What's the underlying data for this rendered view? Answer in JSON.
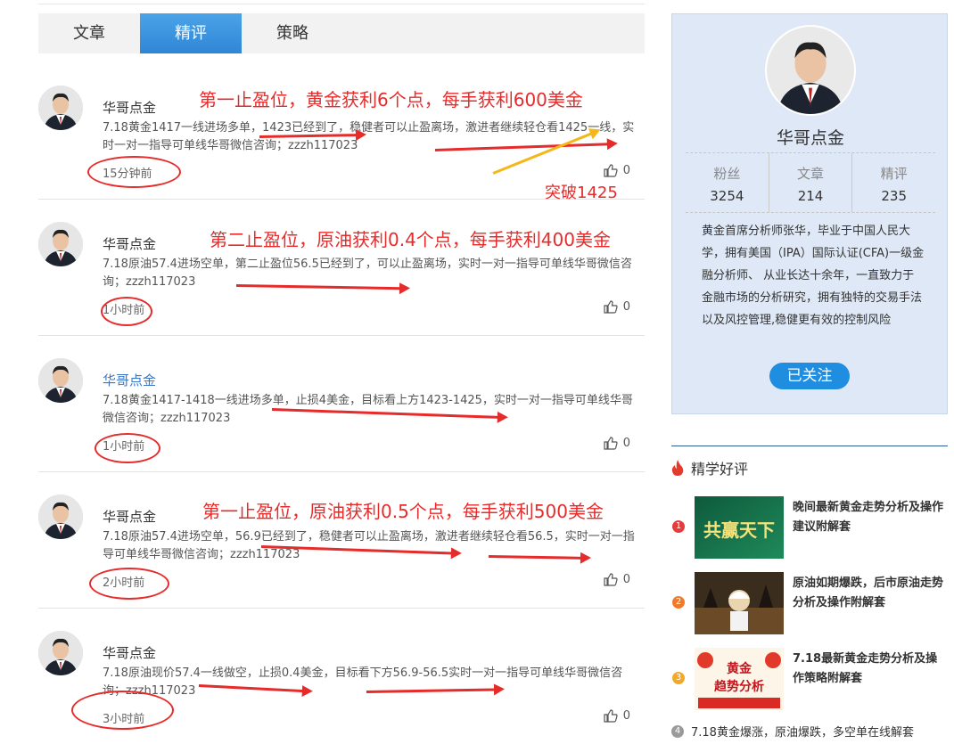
{
  "tabs": [
    {
      "label": "文章"
    },
    {
      "label": "精评"
    },
    {
      "label": "策略"
    }
  ],
  "posts": [
    {
      "author": "华哥点金",
      "content": "7.18黄金1417一线进场多单，1423已经到了，稳健者可以止盈离场，激进者继续轻仓看1425一线，实时一对一指导可单线华哥微信咨询；zzzh117023",
      "time": "15分钟前",
      "likes": "0",
      "headline": "第一止盈位，黄金获利6个点，每手获利600美金",
      "extra_note": "突破1425"
    },
    {
      "author": "华哥点金",
      "content": "7.18原油57.4进场空单，第二止盈位56.5已经到了，可以止盈离场，实时一对一指导可单线华哥微信咨询；zzzh117023",
      "time": "1小时前",
      "likes": "0",
      "headline": "第二止盈位，原油获利0.4个点，每手获利400美金"
    },
    {
      "author": "华哥点金",
      "content": "7.18黄金1417-1418一线进场多单，止损4美金，目标看上方1423-1425，实时一对一指导可单线华哥微信咨询；zzzh117023",
      "time": "1小时前",
      "likes": "0"
    },
    {
      "author": "华哥点金",
      "content": "7.18原油57.4进场空单，56.9已经到了，稳健者可以止盈离场，激进者继续轻仓看56.5，实时一对一指导可单线华哥微信咨询；zzzh117023",
      "time": "2小时前",
      "likes": "0",
      "headline": "第一止盈位，原油获利0.5个点，每手获利500美金"
    },
    {
      "author": "华哥点金",
      "content": "7.18原油现价57.4一线做空，止损0.4美金，目标看下方56.9-56.5实时一对一指导可单线华哥微信咨询；zzzh117023",
      "time": "3小时前",
      "likes": "0"
    }
  ],
  "profile": {
    "name": "华哥点金",
    "stats": [
      {
        "label": "粉丝",
        "value": "3254"
      },
      {
        "label": "文章",
        "value": "214"
      },
      {
        "label": "精评",
        "value": "235"
      }
    ],
    "bio": "黄金首席分析师张华，毕业于中国人民大学，拥有美国（IPA）国际认证(CFA)一级金融分析师、 从业长达十余年，一直致力于金融市场的分析研究，拥有独特的交易手法以及风控管理,稳健更有效的控制风险",
    "follow_label": "已关注"
  },
  "featured": {
    "title": "精学好评",
    "items": [
      {
        "num": "1",
        "color": "#e83c3c",
        "text": "晚间最新黄金走势分析及操作建议附解套",
        "thumb_text": "共赢天下"
      },
      {
        "num": "2",
        "color": "#f07a2a",
        "text": "原油如期爆跌，后市原油走势分析及操作附解套"
      },
      {
        "num": "3",
        "color": "#f3a82a",
        "text": "7.18最新黄金走势分析及操作策略附解套",
        "thumb_text_1": "黄金",
        "thumb_text_2": "趋势分析"
      }
    ],
    "last": {
      "num": "4",
      "text": "7.18黄金爆涨，原油爆跌，多空单在线解套"
    }
  }
}
